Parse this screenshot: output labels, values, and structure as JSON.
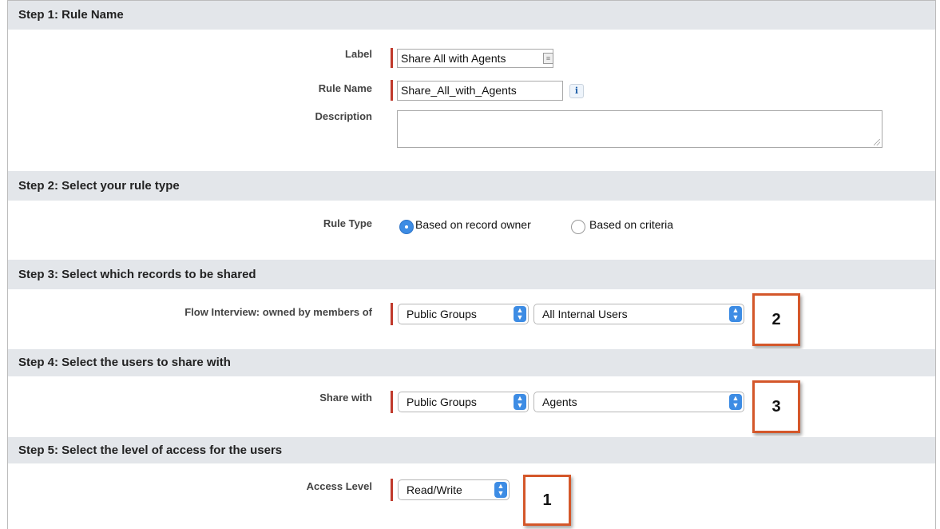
{
  "steps": [
    {
      "title": "Step 1: Rule Name"
    },
    {
      "title": "Step 2: Select your rule type"
    },
    {
      "title": "Step 3: Select which records to be shared"
    },
    {
      "title": "Step 4: Select the users to share with"
    },
    {
      "title": "Step 5: Select the level of access for the users"
    }
  ],
  "step1": {
    "label_label": "Label",
    "label_value": "Share All with Agents",
    "rule_name_label": "Rule Name",
    "rule_name_value": "Share_All_with_Agents",
    "description_label": "Description",
    "description_value": "",
    "info_glyph": "i",
    "contact_icon": "contact-card-icon"
  },
  "step2": {
    "rule_type_label": "Rule Type",
    "options": [
      {
        "label": "Based on record owner",
        "selected": true
      },
      {
        "label": "Based on criteria",
        "selected": false
      }
    ]
  },
  "step3": {
    "field_label": "Flow Interview: owned by members of",
    "group_type": "Public Groups",
    "group_value": "All Internal Users",
    "callout": "2"
  },
  "step4": {
    "field_label": "Share with",
    "group_type": "Public Groups",
    "group_value": "Agents",
    "callout": "3"
  },
  "step5": {
    "field_label": "Access Level",
    "access_value": "Read/Write",
    "callout": "1"
  },
  "colors": {
    "header_bg": "#e3e6ea",
    "required_bar": "#c0392b",
    "select_accent": "#3d8ce4",
    "callout_border": "#d4572a"
  }
}
